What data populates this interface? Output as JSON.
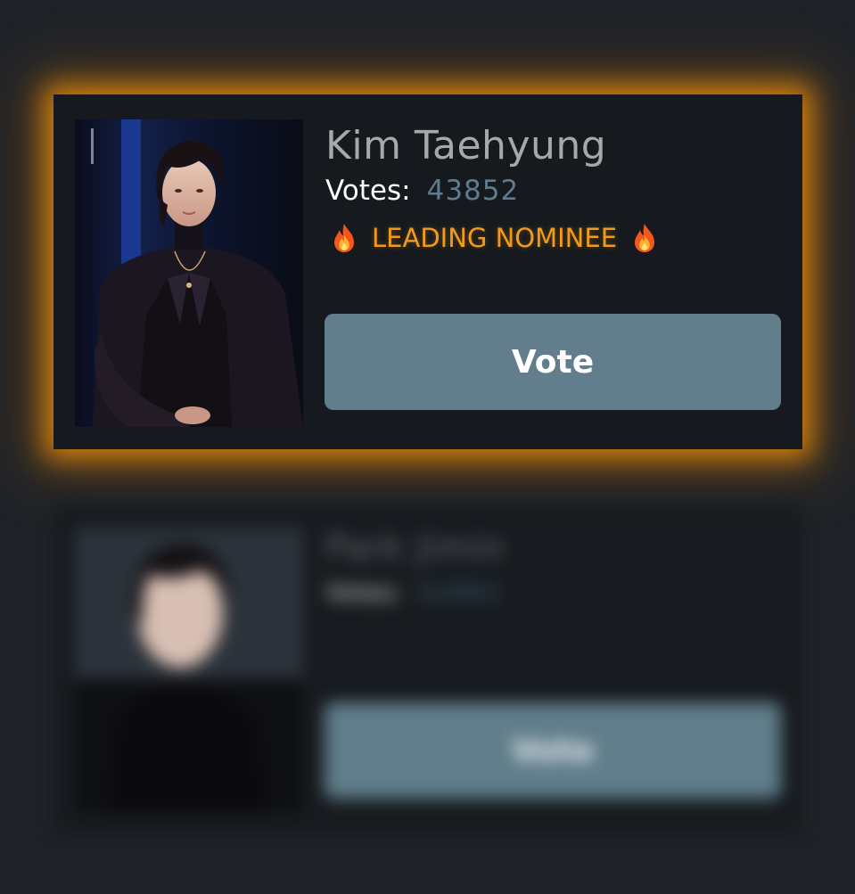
{
  "cards": [
    {
      "name": "Kim Taehyung",
      "votes_label": "Votes:",
      "votes_count": "43852",
      "badge": "LEADING NOMINEE",
      "badge_icon": "fire-emoji",
      "vote_button": "Vote",
      "highlight_color": "#f39a1a"
    },
    {
      "name": "Park Jimin",
      "votes_label": "Votes:",
      "votes_count": "42961",
      "vote_button": "Vote",
      "blurred": true
    }
  ],
  "colors": {
    "background": "#1f2328",
    "card": "#161a1e",
    "button": "#627e8c",
    "votes_count": "#5e7c8e",
    "glow": "#e68c0a"
  }
}
